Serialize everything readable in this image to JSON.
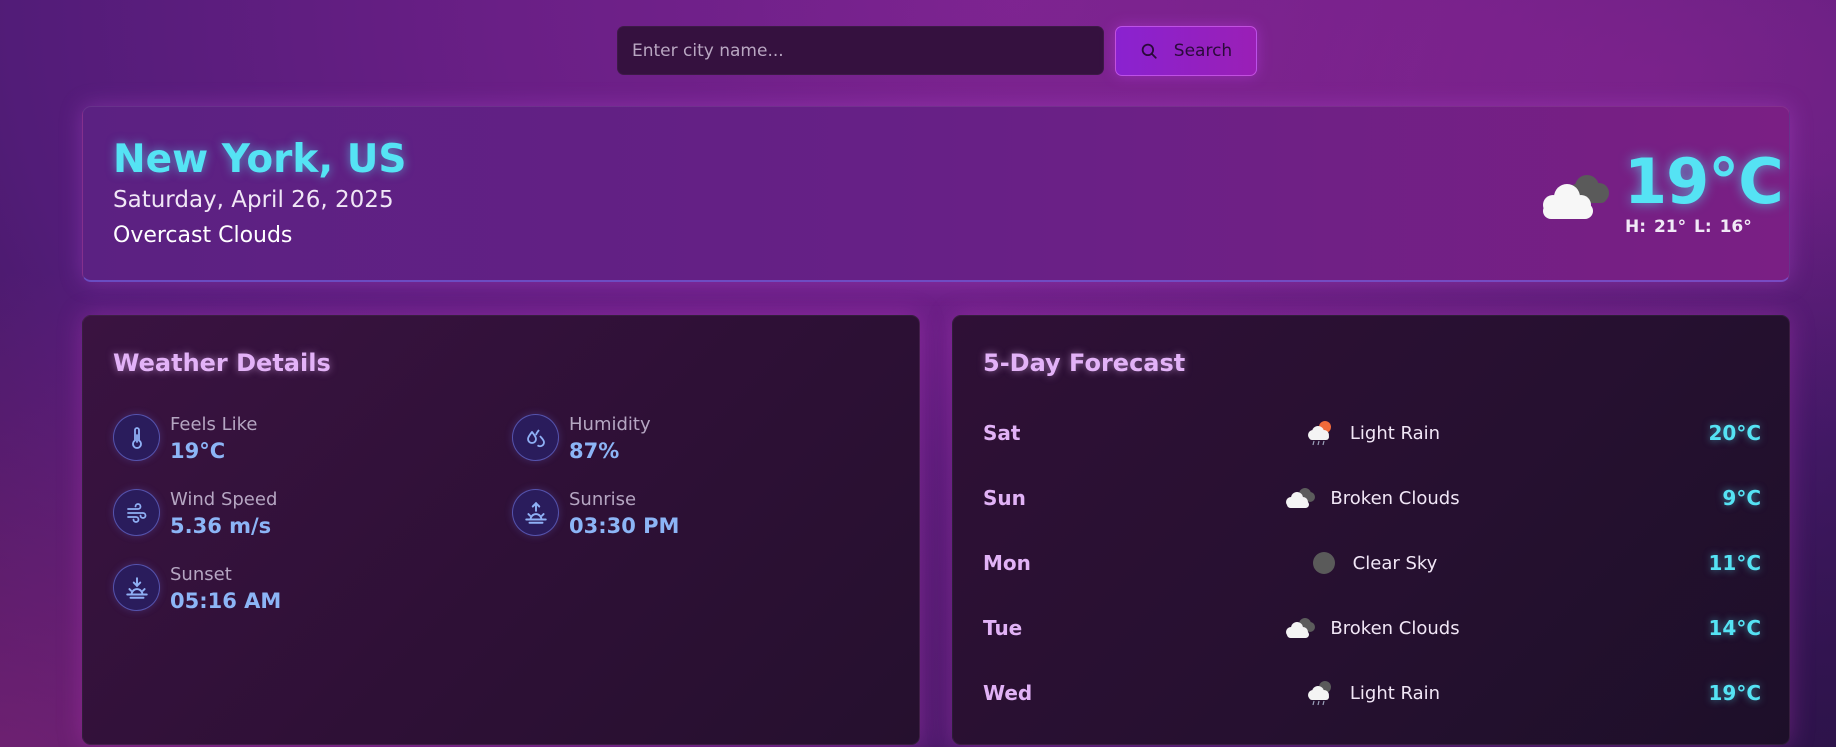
{
  "search": {
    "placeholder": "Enter city name...",
    "button_label": "Search",
    "button_icon": "search-icon"
  },
  "current": {
    "city": "New York, US",
    "date": "Saturday, April 26, 2025",
    "condition": "Overcast Clouds",
    "temperature": "19°C",
    "hilo": "H: 21°  L: 16°",
    "icon": "overcast-clouds-icon"
  },
  "details": {
    "title": "Weather Details",
    "items": [
      {
        "label": "Feels Like",
        "value": "19°C",
        "icon": "thermometer-icon"
      },
      {
        "label": "Humidity",
        "value": "87%",
        "icon": "droplets-icon"
      },
      {
        "label": "Wind Speed",
        "value": "5.36 m/s",
        "icon": "wind-icon"
      },
      {
        "label": "Sunrise",
        "value": "03:30 PM",
        "icon": "sunrise-icon"
      },
      {
        "label": "Sunset",
        "value": "05:16 AM",
        "icon": "sunset-icon"
      }
    ]
  },
  "forecast": {
    "title": "5-Day Forecast",
    "days": [
      {
        "day": "Sat",
        "desc": "Light Rain",
        "temp": "20°C",
        "icon": "light-rain-icon"
      },
      {
        "day": "Sun",
        "desc": "Broken Clouds",
        "temp": "9°C",
        "icon": "broken-clouds-icon"
      },
      {
        "day": "Mon",
        "desc": "Clear Sky",
        "temp": "11°C",
        "icon": "clear-sky-icon"
      },
      {
        "day": "Tue",
        "desc": "Broken Clouds",
        "temp": "14°C",
        "icon": "broken-clouds-icon"
      },
      {
        "day": "Wed",
        "desc": "Light Rain",
        "temp": "19°C",
        "icon": "light-rain-icon"
      }
    ]
  },
  "colors": {
    "accent_cyan": "#55e3f4",
    "title_lilac": "#e3b2f8",
    "detail_value_blue": "#8cb5f6",
    "button_purple": "#8a22d0"
  }
}
